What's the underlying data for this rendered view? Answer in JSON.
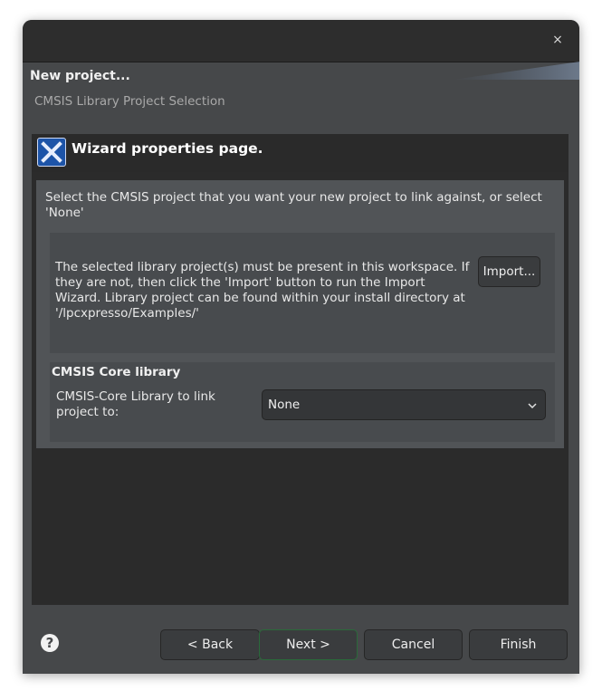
{
  "window": {
    "title": "New project...",
    "subtitle": "CMSIS Library Project Selection",
    "close_icon": "×"
  },
  "page": {
    "title": "Wizard properties page.",
    "intro": "Select the CMSIS project that you want your new project to link against, or select 'None'",
    "info": "The selected library project(s) must be present in this workspace. If they are not, then click the 'Import' button to run the Import Wizard. Library project can be found within your install directory at '/lpcxpresso/Examples/'",
    "import_label": "Import..."
  },
  "core": {
    "group_title": "CMSIS Core library",
    "label": "CMSIS-Core Library to link project to:",
    "selected": "None"
  },
  "buttons": {
    "help": "?",
    "back": "< Back",
    "next": "Next >",
    "cancel": "Cancel",
    "finish": "Finish"
  },
  "colors": {
    "window_bg": "#46484a",
    "titlebar_bg": "#2d2d2d",
    "logo_blue": "#1d54a8"
  },
  "icons": {
    "close": "close-icon",
    "logo": "wizard-logo-icon",
    "dropdown": "chevron-down-icon",
    "help": "help-icon"
  }
}
